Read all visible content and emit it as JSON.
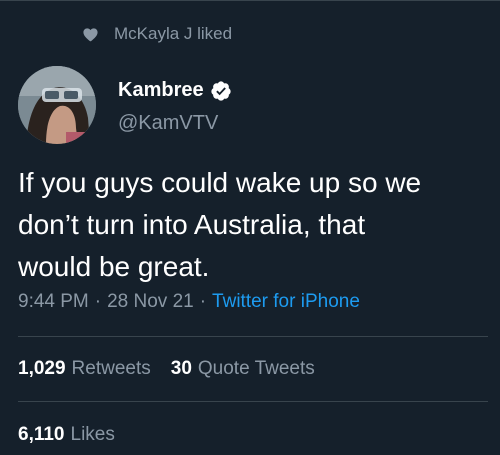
{
  "social_context": {
    "text": "McKayla J liked",
    "icon": "heart-icon"
  },
  "author": {
    "name": "Kambree",
    "handle": "@KamVTV",
    "verified_icon": "verified-badge-icon",
    "verified_color": "#1d9bf0"
  },
  "tweet": {
    "text": "If you guys could wake up so we\ndon’t turn into Australia, that\nwould be great.",
    "time": "9:44 PM",
    "date": "28 Nov 21",
    "source": "Twitter for iPhone",
    "separator": "·"
  },
  "stats": {
    "retweets_count": "1,029",
    "retweets_label": "Retweets",
    "quotes_count": "30",
    "quotes_label": "Quote Tweets",
    "likes_count": "6,110",
    "likes_label": "Likes"
  },
  "colors": {
    "background": "#15202b",
    "text_primary": "#ffffff",
    "text_secondary": "#8b98a5",
    "accent": "#1d9bf0",
    "divider": "#38444d"
  }
}
